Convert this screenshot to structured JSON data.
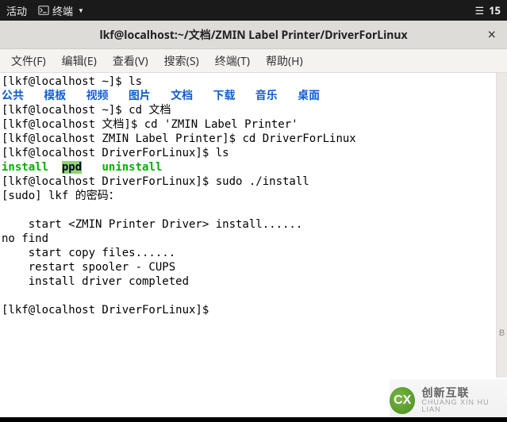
{
  "topbar": {
    "activities": "活动",
    "terminal_label": "终端",
    "menu_icon": "☰",
    "date_fragment": "15"
  },
  "titlebar": {
    "title": "lkf@localhost:~/文档/ZMIN Label Printer/DriverForLinux",
    "close": "×"
  },
  "menubar": {
    "file": "文件(F)",
    "edit": "编辑(E)",
    "view": "查看(V)",
    "search": "搜索(S)",
    "terminal": "终端(T)",
    "help": "帮助(H)"
  },
  "terminal": {
    "line1_prompt": "[lkf@localhost ~]$ ",
    "line1_cmd": "ls",
    "dirs": {
      "d1": "公共",
      "d2": "模板",
      "d3": "视频",
      "d4": "图片",
      "d5": "文档",
      "d6": "下载",
      "d7": "音乐",
      "d8": "桌面"
    },
    "line3_prompt": "[lkf@localhost ~]$ ",
    "line3_cmd": "cd 文档",
    "line4_prompt": "[lkf@localhost 文档]$ ",
    "line4_cmd": "cd 'ZMIN Label Printer'",
    "line5_prompt": "[lkf@localhost ZMIN Label Printer]$ ",
    "line5_cmd": "cd DriverForLinux",
    "line6_prompt": "[lkf@localhost DriverForLinux]$ ",
    "line6_cmd": "ls",
    "exec1": "install",
    "ppd": "ppd",
    "exec2": "uninstall",
    "line8_prompt": "[lkf@localhost DriverForLinux]$ ",
    "line8_cmd": "sudo ./install",
    "line9": "[sudo] lkf 的密码：",
    "blank": "",
    "line11": "    start <ZMIN Printer Driver> install......",
    "line12": "no find",
    "line13": "    start copy files......",
    "line14": "    restart spooler - CUPS",
    "line15": "    install driver completed",
    "line17_prompt": "[lkf@localhost DriverForLinux]$ "
  },
  "watermark": {
    "logo_text": "CX",
    "line1": "创新互联",
    "line2": "CHUANG XIN HU LIAN"
  },
  "scrollbar_hint": "B"
}
